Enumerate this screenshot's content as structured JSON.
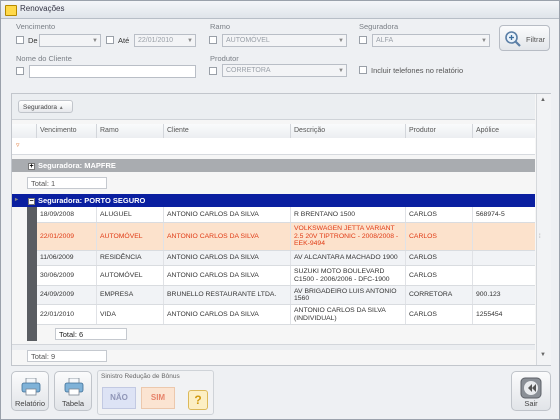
{
  "window": {
    "title": "Renovações"
  },
  "filters": {
    "vencimento_label": "Vencimento",
    "de_label": "De",
    "ate_label": "Até",
    "ate_value": "22/01/2010",
    "ramo_label": "Ramo",
    "ramo_value": "AUTOMÓVEL",
    "seguradora_label": "Seguradora",
    "seguradora_value": "ALFA",
    "nome_label": "Nome do Cliente",
    "produtor_label": "Produtor",
    "produtor_value": "CORRETORA",
    "incluir_label": "Incluir telefones no relatório",
    "filtrar_label": "Filtrar"
  },
  "grid": {
    "group_chip": "Seguradora",
    "columns": [
      "Vencimento",
      "Ramo",
      "Cliente",
      "Descrição",
      "Produtor",
      "Apólice"
    ],
    "groups": [
      {
        "label": "Seguradora: MAPFRE",
        "expanded": false,
        "total": "Total: 1"
      },
      {
        "label": "Seguradora: PORTO SEGURO",
        "expanded": true,
        "total": "Total: 6"
      }
    ],
    "rows": [
      {
        "vencimento": "18/09/2008",
        "ramo": "ALUGUEL",
        "cliente": "ANTONIO CARLOS DA SILVA",
        "descricao": "R BRENTANO 1500",
        "produtor": "CARLOS",
        "apolice": "568974-5"
      },
      {
        "vencimento": "22/01/2009",
        "ramo": "AUTOMÓVEL",
        "cliente": "ANTONIO CARLOS DA SILVA",
        "descricao": "VOLKSWAGEN JETTA VARIANT 2.5 20V TIPTRONIC - 2008/2008 - EEK-9494",
        "produtor": "CARLOS",
        "apolice": ""
      },
      {
        "vencimento": "11/06/2009",
        "ramo": "RESIDÊNCIA",
        "cliente": "ANTONIO CARLOS DA SILVA",
        "descricao": "AV ALCANTARA MACHADO 1900",
        "produtor": "CARLOS",
        "apolice": ""
      },
      {
        "vencimento": "30/06/2009",
        "ramo": "AUTOMÓVEL",
        "cliente": "ANTONIO CARLOS DA SILVA",
        "descricao": "SUZUKI MOTO BOULEVARD C1500 - 2006/2006 - DFC-1900",
        "produtor": "CARLOS",
        "apolice": ""
      },
      {
        "vencimento": "24/09/2009",
        "ramo": "EMPRESA",
        "cliente": "BRUNELLO RESTAURANTE LTDA.",
        "descricao": "AV BRIGADEIRO LUIS ANTONIO 1560",
        "produtor": "CORRETORA",
        "apolice": "900.123"
      },
      {
        "vencimento": "22/01/2010",
        "ramo": "VIDA",
        "cliente": "ANTONIO CARLOS DA SILVA",
        "descricao": "ANTONIO CARLOS DA SILVA (INDIVIDUAL)",
        "produtor": "CARLOS",
        "apolice": "1255454"
      }
    ],
    "grand_total": "Total: 9"
  },
  "bottom": {
    "relatorio_label": "Relatório",
    "tabela_label": "Tabela",
    "sinistro_label": "Sinistro Redução de Bônus",
    "nao_label": "NÃO",
    "sim_label": "SIM",
    "help_label": "?",
    "sair_label": "Sair"
  },
  "colors": {
    "group_mapfre": "#a9acb0",
    "group_porto": "#0a1fa0",
    "selected_row": "#fce2cc",
    "selected_text": "#e03a14"
  }
}
